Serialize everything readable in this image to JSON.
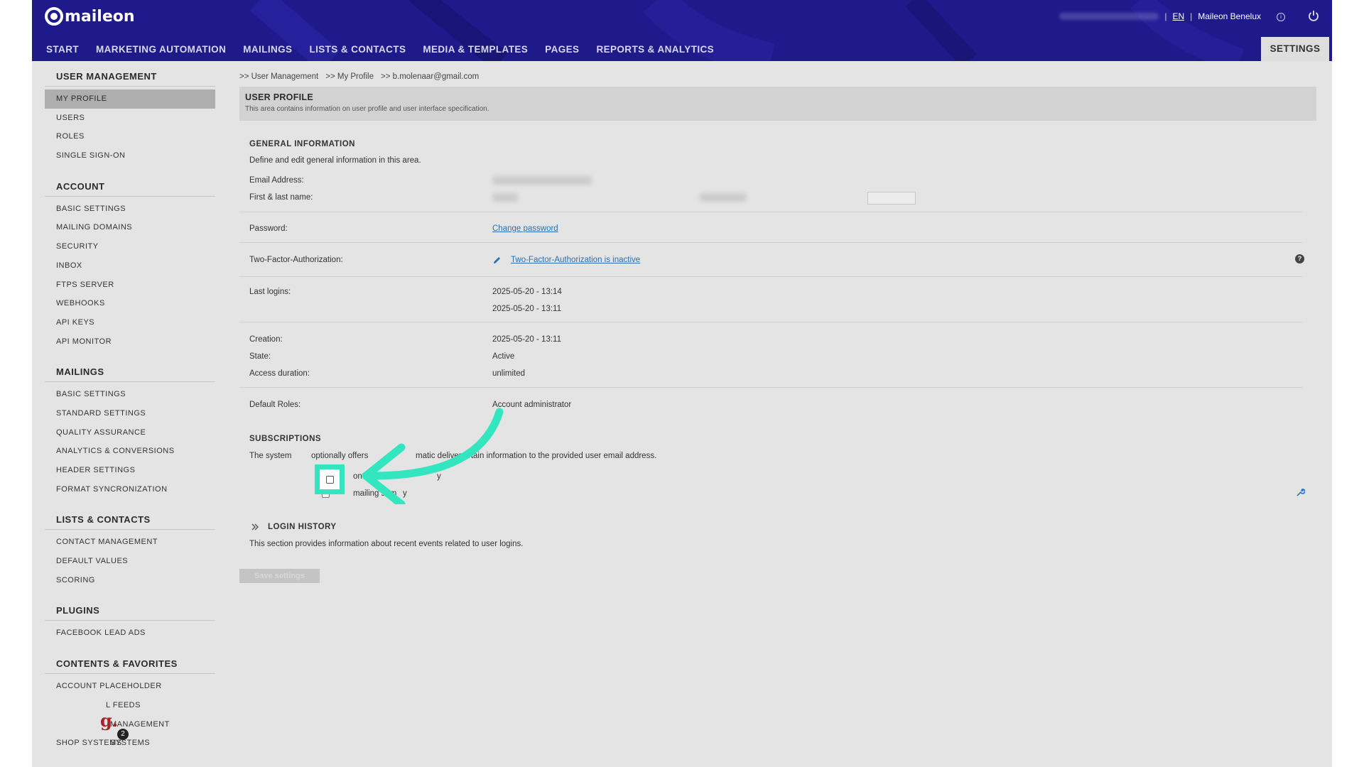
{
  "header": {
    "logo_text": "maileon",
    "lang": "EN",
    "account": "Maileon Benelux",
    "nav": [
      "START",
      "MARKETING AUTOMATION",
      "MAILINGS",
      "LISTS & CONTACTS",
      "MEDIA & TEMPLATES",
      "PAGES",
      "REPORTS & ANALYTICS"
    ],
    "settings_tab": "SETTINGS",
    "colors": {
      "header_bg": "#1f1a8c",
      "accent": "#33e6c0"
    }
  },
  "sidebar": {
    "groups": [
      {
        "title": "USER MANAGEMENT",
        "items": [
          "MY PROFILE",
          "USERS",
          "ROLES",
          "SINGLE SIGN-ON"
        ]
      },
      {
        "title": "ACCOUNT",
        "items": [
          "BASIC SETTINGS",
          "MAILING DOMAINS",
          "SECURITY",
          "INBOX",
          "FTPS SERVER",
          "WEBHOOKS",
          "API KEYS",
          "API MONITOR"
        ]
      },
      {
        "title": "MAILINGS",
        "items": [
          "BASIC SETTINGS",
          "STANDARD SETTINGS",
          "QUALITY ASSURANCE",
          "ANALYTICS & CONVERSIONS",
          "HEADER SETTINGS",
          "FORMAT SYNCRONIZATION"
        ]
      },
      {
        "title": "LISTS & CONTACTS",
        "items": [
          "CONTACT MANAGEMENT",
          "DEFAULT VALUES",
          "SCORING"
        ]
      },
      {
        "title": "PLUGINS",
        "items": [
          "FACEBOOK LEAD ADS"
        ]
      },
      {
        "title": "CONTENTS & FAVORITES",
        "items": [
          "ACCOUNT PLACEHOLDER",
          "L FEEDS",
          "MANAGEMENT SYSTEMS",
          "SHOP SYSTEMS"
        ]
      }
    ],
    "active_item": "MY PROFILE"
  },
  "breadcrumb": [
    ">> User Management",
    ">> My Profile",
    ">> b.molenaar@gmail.com"
  ],
  "page": {
    "title": "USER PROFILE",
    "description": "This area contains information on user profile and user interface specification."
  },
  "general": {
    "title": "GENERAL INFORMATION",
    "description": "Define and edit general information in this area.",
    "email_label": "Email Address:",
    "name_label": "First & last name:",
    "password_label": "Password:",
    "password_link": "Change password",
    "tfa_label": "Two-Factor-Authorization:",
    "tfa_link": "Two-Factor-Authorization is inactive",
    "last_logins_label": "Last logins:",
    "last_logins": [
      "2025-05-20 - 13:14",
      "2025-05-20 - 13:11"
    ],
    "creation_label": "Creation:",
    "creation": "2025-05-20 - 13:11",
    "state_label": "State:",
    "state": "Active",
    "access_label": "Access duration:",
    "access": "unlimited",
    "roles_label": "Default Roles:",
    "roles": "Account administrator"
  },
  "subscriptions": {
    "title": "SUBSCRIPTIONS",
    "description_start": "The system",
    "description_mid": "optionally offers",
    "description_tail": "matic delivery",
    "description_end": "rtain information to the provided user email address.",
    "item1": "onthly",
    "item2_tail": "y",
    "item3": "mailing sum",
    "item3_tail": "y"
  },
  "login_history": {
    "title": "LOGIN HISTORY",
    "description": "This section provides information about recent events related to user logins."
  },
  "save_button": "Save settings",
  "badge": {
    "letter": "g.",
    "count": "2"
  }
}
